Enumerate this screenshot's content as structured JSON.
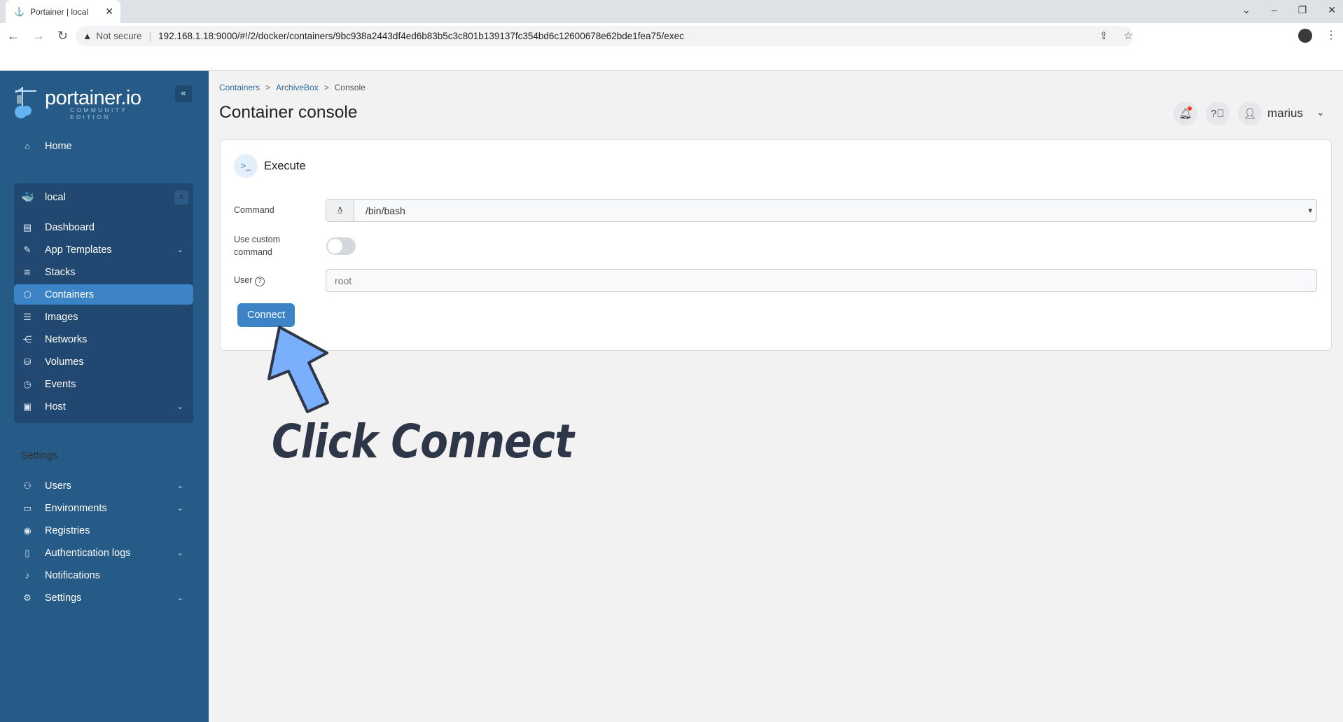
{
  "browser": {
    "tab_title": "Portainer | local",
    "not_secure": "Not secure",
    "url": "192.168.1.18:9000/#!/2/docker/containers/9bc938a2443df4ed6b83b5c3c801b139137fc354bd6c12600678e62bde1fea75/exec"
  },
  "sidebar": {
    "brand": "portainer.io",
    "edition": "COMMUNITY EDITION",
    "home": "Home",
    "env_name": "local",
    "env_items": [
      {
        "label": "Dashboard",
        "icon": "dashboard-icon"
      },
      {
        "label": "App Templates",
        "icon": "edit-icon",
        "chevron": true
      },
      {
        "label": "Stacks",
        "icon": "layers-icon"
      },
      {
        "label": "Containers",
        "icon": "box-icon",
        "active": true
      },
      {
        "label": "Images",
        "icon": "list-icon"
      },
      {
        "label": "Networks",
        "icon": "share-icon"
      },
      {
        "label": "Volumes",
        "icon": "database-icon"
      },
      {
        "label": "Events",
        "icon": "clock-icon"
      },
      {
        "label": "Host",
        "icon": "host-icon",
        "chevron": true
      }
    ],
    "settings_header": "Settings",
    "settings_items": [
      {
        "label": "Users",
        "icon": "users-icon",
        "chevron": true
      },
      {
        "label": "Environments",
        "icon": "hard-drive-icon",
        "chevron": true
      },
      {
        "label": "Registries",
        "icon": "radio-icon"
      },
      {
        "label": "Authentication logs",
        "icon": "file-text-icon",
        "chevron": true
      },
      {
        "label": "Notifications",
        "icon": "bell-icon"
      },
      {
        "label": "Settings",
        "icon": "gear-icon",
        "chevron": true
      }
    ]
  },
  "header": {
    "breadcrumb": [
      "Containers",
      "ArchiveBox",
      "Console"
    ],
    "title": "Container console",
    "username": "marius"
  },
  "form": {
    "section_title": "Execute",
    "command_label": "Command",
    "command_value": "/bin/bash",
    "custom_label": "Use custom command",
    "custom_enabled": false,
    "user_label": "User",
    "user_placeholder": "root",
    "connect_label": "Connect"
  },
  "annotation": {
    "text": "Click Connect"
  },
  "colors": {
    "sidebar": "#265a87",
    "accent": "#3d84c6",
    "arrow": "#7ab0fb",
    "annotation": "#2d3748"
  }
}
